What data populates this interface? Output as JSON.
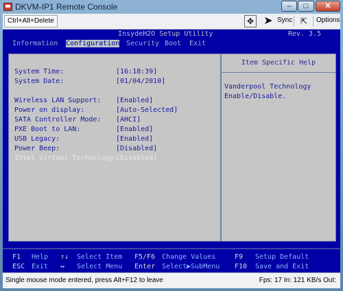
{
  "window": {
    "title": "DKVM-IP1 Remote Console",
    "buttons": {
      "minimize": "–",
      "maximize": "□",
      "close": "✕"
    }
  },
  "toolbar": {
    "ctrl_alt_delete": "Ctrl+Alt+Delete",
    "sync_label": "Sync",
    "options_label": "Options"
  },
  "bios": {
    "title": "InsydeH2O Setup Utility",
    "rev": "Rev. 3.5",
    "menus": [
      "Information",
      "Configuration",
      "Security",
      "Boot",
      "Exit"
    ],
    "active_menu": "Configuration",
    "settings": [
      {
        "label": "System Time:",
        "value": "[16:18:39]"
      },
      {
        "label": "System Date:",
        "value": "[01/04/2010]"
      },
      {
        "label": "Wireless LAN Support:",
        "value": "[Enabled]"
      },
      {
        "label": "Power on display:",
        "value": "[Auto-Selected]"
      },
      {
        "label": "SATA Controller Mode:",
        "value": "[AHCI]"
      },
      {
        "label": "PXE Boot to LAN:",
        "value": "[Enabled]"
      },
      {
        "label": "USB Legacy:",
        "value": "[Enabled]"
      },
      {
        "label": "Power Beep:",
        "value": "[Disabled]"
      },
      {
        "label": "Intel Virtual Technology:",
        "value": "[Disabled]"
      }
    ],
    "help": {
      "title": "Item Specific Help",
      "text": "Vanderpool Technology\nEnable/Disable."
    },
    "status": {
      "f1": "F1",
      "help": "Help",
      "updown": "↑↓",
      "select_item": "Select Item",
      "f5f6": "F5/F6",
      "change_values": "Change Values",
      "f9": "F9",
      "setup_default": "Setup Default",
      "esc": "ESC",
      "exit": "Exit",
      "leftright": "↔",
      "select_menu": "Select Menu",
      "enter": "Enter",
      "select_submenu": "Select▶SubMenu",
      "f10": "F10",
      "save_exit": "Save and Exit"
    }
  },
  "statusbar": {
    "message": "Single mouse mode entered, press Alt+F12 to leave",
    "fps": "Fps: 17 In: 121 KB/s Out:"
  }
}
